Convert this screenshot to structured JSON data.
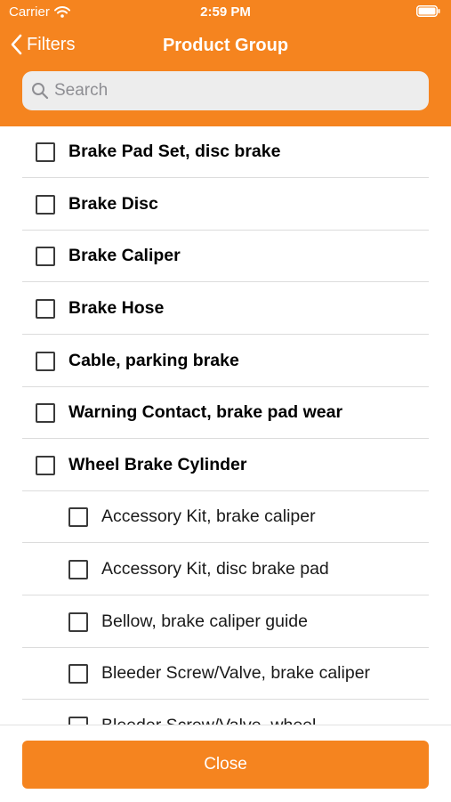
{
  "status_bar": {
    "carrier": "Carrier",
    "time": "2:59 PM"
  },
  "nav": {
    "back_label": "Filters",
    "title": "Product Group"
  },
  "search": {
    "placeholder": "Search",
    "value": ""
  },
  "items": [
    {
      "label": "Brake Pad Set, disc brake",
      "level": "parent",
      "checked": false
    },
    {
      "label": "Brake Disc",
      "level": "parent",
      "checked": false
    },
    {
      "label": "Brake Caliper",
      "level": "parent",
      "checked": false
    },
    {
      "label": "Brake Hose",
      "level": "parent",
      "checked": false
    },
    {
      "label": "Cable, parking brake",
      "level": "parent",
      "checked": false
    },
    {
      "label": "Warning Contact, brake pad wear",
      "level": "parent",
      "checked": false
    },
    {
      "label": "Wheel Brake Cylinder",
      "level": "parent",
      "checked": false
    },
    {
      "label": "Accessory Kit, brake caliper",
      "level": "child",
      "checked": false
    },
    {
      "label": "Accessory Kit, disc brake pad",
      "level": "child",
      "checked": false
    },
    {
      "label": "Bellow, brake caliper guide",
      "level": "child",
      "checked": false
    },
    {
      "label": "Bleeder Screw/Valve, brake caliper",
      "level": "child",
      "checked": false
    },
    {
      "label": "Bleeder Screw/Valve, wheel",
      "level": "child",
      "checked": false
    }
  ],
  "footer": {
    "close_label": "Close"
  },
  "colors": {
    "accent": "#f5841f",
    "divider": "#dcdcdc",
    "search_bg": "#ededed"
  },
  "icons": {
    "back": "chevron-left-icon",
    "search": "search-icon",
    "wifi": "wifi-icon",
    "battery": "battery-icon"
  }
}
